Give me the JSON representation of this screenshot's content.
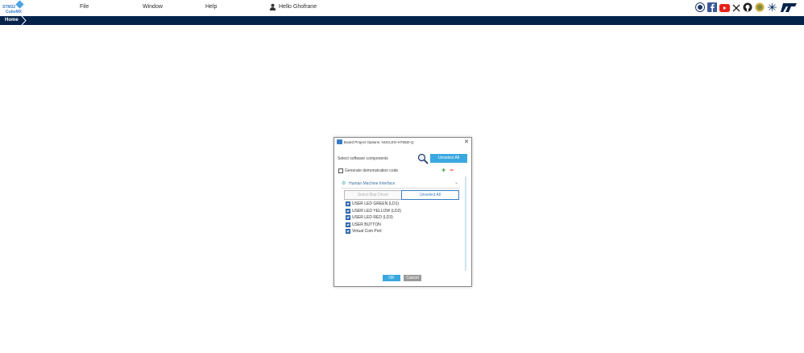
{
  "app": {
    "logo_line1": "STM32",
    "logo_line2": "CubeMX"
  },
  "menu": {
    "file": "File",
    "window": "Window",
    "help": "Help",
    "user_greeting": "Hello Ghofrane"
  },
  "social_icons": [
    "anniversary-icon",
    "facebook-icon",
    "youtube-icon",
    "x-icon",
    "github-icon",
    "community-icon",
    "network-icon",
    "st-logo-icon"
  ],
  "breadcrumb": {
    "home": "Home"
  },
  "dialog": {
    "title": "Board Project Options: NUCLEO-H755ZI-Q",
    "close": "✕",
    "select_label": "Select software components",
    "unselect_all_top": "Unselect All",
    "generate_demo": "Generate demonstration code",
    "section_name": "Human Machine Interface",
    "select_bsp": "Select Bsp Driver",
    "unselect_all": "Unselect All",
    "items": [
      "USER LED GREEN (LD1)",
      "USER LED YELLOW (LD2)",
      "USER LED RED (LD3)",
      "USER BUTTON",
      "Virtual Com Port"
    ],
    "ok": "OK",
    "cancel": "Cancel"
  },
  "colors": {
    "breadcrumb_bg": "#03234b",
    "accent": "#3aa8e0"
  }
}
